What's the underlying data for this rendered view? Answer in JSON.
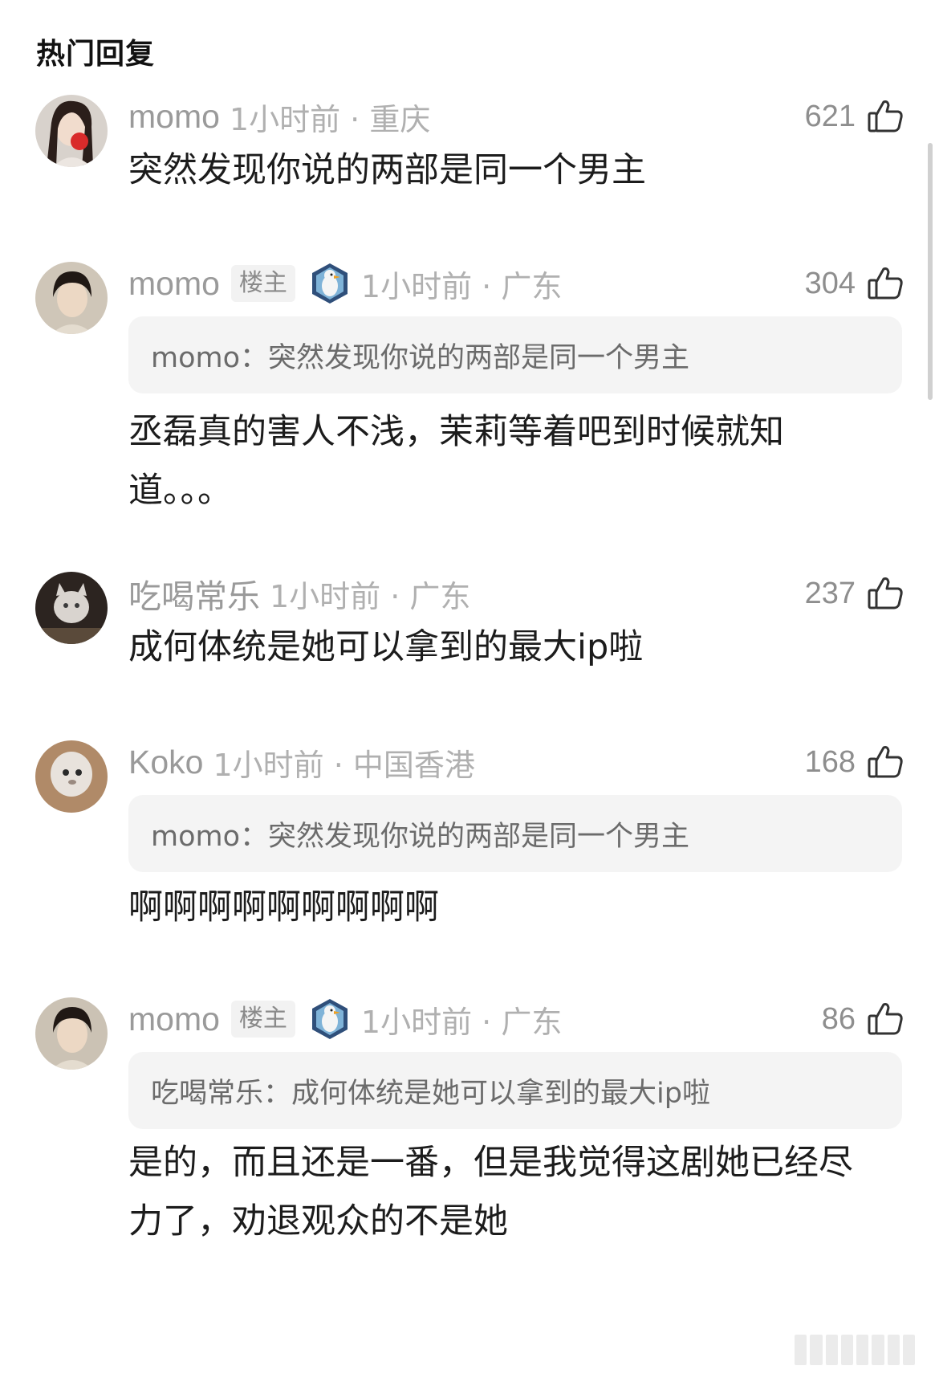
{
  "section_title": "热门回复",
  "comments": [
    {
      "username": "momo",
      "is_op": false,
      "op_badge": "",
      "time_location": "1小时前 · 重庆",
      "likes": "621",
      "quote": null,
      "body": "突然发现你说的两部是同一个男主"
    },
    {
      "username": "momo",
      "is_op": true,
      "op_badge": "楼主",
      "time_location": "1小时前 · 广东",
      "likes": "304",
      "quote": {
        "author": "momo：",
        "text": "突然发现你说的两部是同一个男主"
      },
      "body": "丞磊真的害人不浅，茉莉等着吧到时候就知道。。。"
    },
    {
      "username": "吃喝常乐",
      "is_op": false,
      "op_badge": "",
      "time_location": "1小时前 · 广东",
      "likes": "237",
      "quote": null,
      "body": "成何体统是她可以拿到的最大ip啦"
    },
    {
      "username": "Koko",
      "is_op": false,
      "op_badge": "",
      "time_location": "1小时前 · 中国香港",
      "likes": "168",
      "quote": {
        "author": "momo：",
        "text": "突然发现你说的两部是同一个男主"
      },
      "body": "啊啊啊啊啊啊啊啊啊"
    },
    {
      "username": "momo",
      "is_op": true,
      "op_badge": "楼主",
      "time_location": "1小时前 · 广东",
      "likes": "86",
      "quote": {
        "author": "吃喝常乐：",
        "text": "成何体统是她可以拿到的最大ip啦"
      },
      "body": "是的，而且还是一番，但是我觉得这剧她已经尽力了，劝退观众的不是她"
    }
  ],
  "icons": {
    "like": "thumbs-up-icon",
    "medal": "penguin-medal-icon"
  },
  "colors": {
    "username": "#9a9a9a",
    "meta": "#b0b0b0",
    "quote_bg": "#f4f4f4",
    "body_text": "#1c1c1c"
  }
}
